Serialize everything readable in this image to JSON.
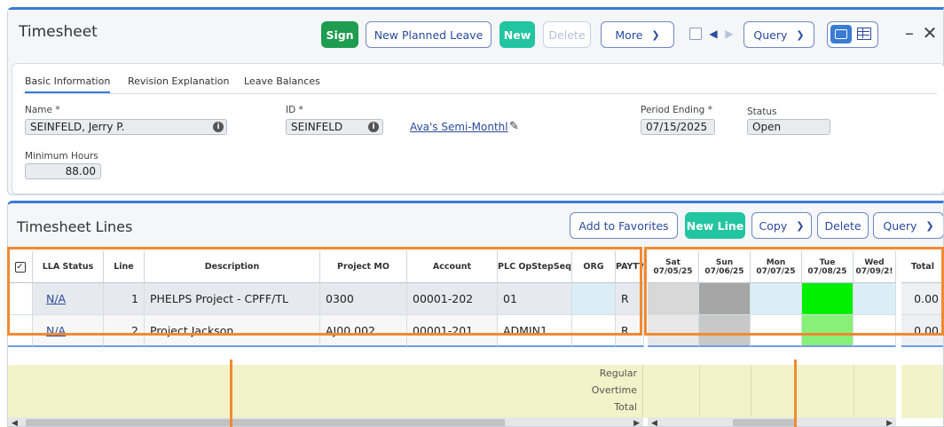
{
  "header": {
    "title": "Timesheet",
    "sign": "Sign",
    "new_planned_leave": "New Planned Leave",
    "new": "New",
    "delete": "Delete",
    "more": "More",
    "query": "Query"
  },
  "tabs": [
    "Basic Information",
    "Revision Explanation",
    "Leave Balances"
  ],
  "info": {
    "name_label": "Name *",
    "name_value": "SEINFELD, Jerry P.",
    "id_label": "ID *",
    "id_value": "SEINFELD",
    "schedule_link": "Ava's Semi-Monthl",
    "period_label": "Period Ending *",
    "period_value": "07/15/2025",
    "status_label": "Status",
    "status_value": "Open",
    "min_hours_label": "Minimum Hours",
    "min_hours_value": "88.00"
  },
  "lines": {
    "title": "Timesheet Lines",
    "add_favorites": "Add to Favorites",
    "new_line": "New Line",
    "copy": "Copy",
    "delete": "Delete",
    "query": "Query"
  },
  "columns": {
    "lla_status": "LLA Status",
    "line": "Line",
    "description": "Description",
    "project_mo": "Project MO",
    "account": "Account",
    "plc": "PLC OpStepSeq",
    "org": "ORG",
    "paytype": "PAYTY",
    "days": [
      {
        "dow": "Sat",
        "date": "07/05/25"
      },
      {
        "dow": "Sun",
        "date": "07/06/25"
      },
      {
        "dow": "Mon",
        "date": "07/07/25"
      },
      {
        "dow": "Tue",
        "date": "07/08/25"
      },
      {
        "dow": "Wed",
        "date": "07/09/2!"
      }
    ],
    "total": "Total"
  },
  "rows": [
    {
      "lla": "N/A",
      "line": "1",
      "description": "PHELPS Project - CPFF/TL",
      "project": "0300",
      "account": "00001-202",
      "plc": "01",
      "org": "",
      "paytype": "R",
      "total": "0.00"
    },
    {
      "lla": "N/A",
      "line": "2",
      "description": "Project Jackson",
      "project": "AJ00.002",
      "account": "00001-201",
      "plc": "ADMIN1",
      "org": "",
      "paytype": "R",
      "total": "0.00"
    }
  ],
  "summary": [
    "Regular",
    "Overtime",
    "Total"
  ],
  "colors": {
    "accent": "#3a7bd5",
    "sign": "#1e9c4f",
    "teal": "#22c5a0",
    "highlight": "#f08a33",
    "green_bright": "#00ee00",
    "green_light": "#88f078"
  }
}
